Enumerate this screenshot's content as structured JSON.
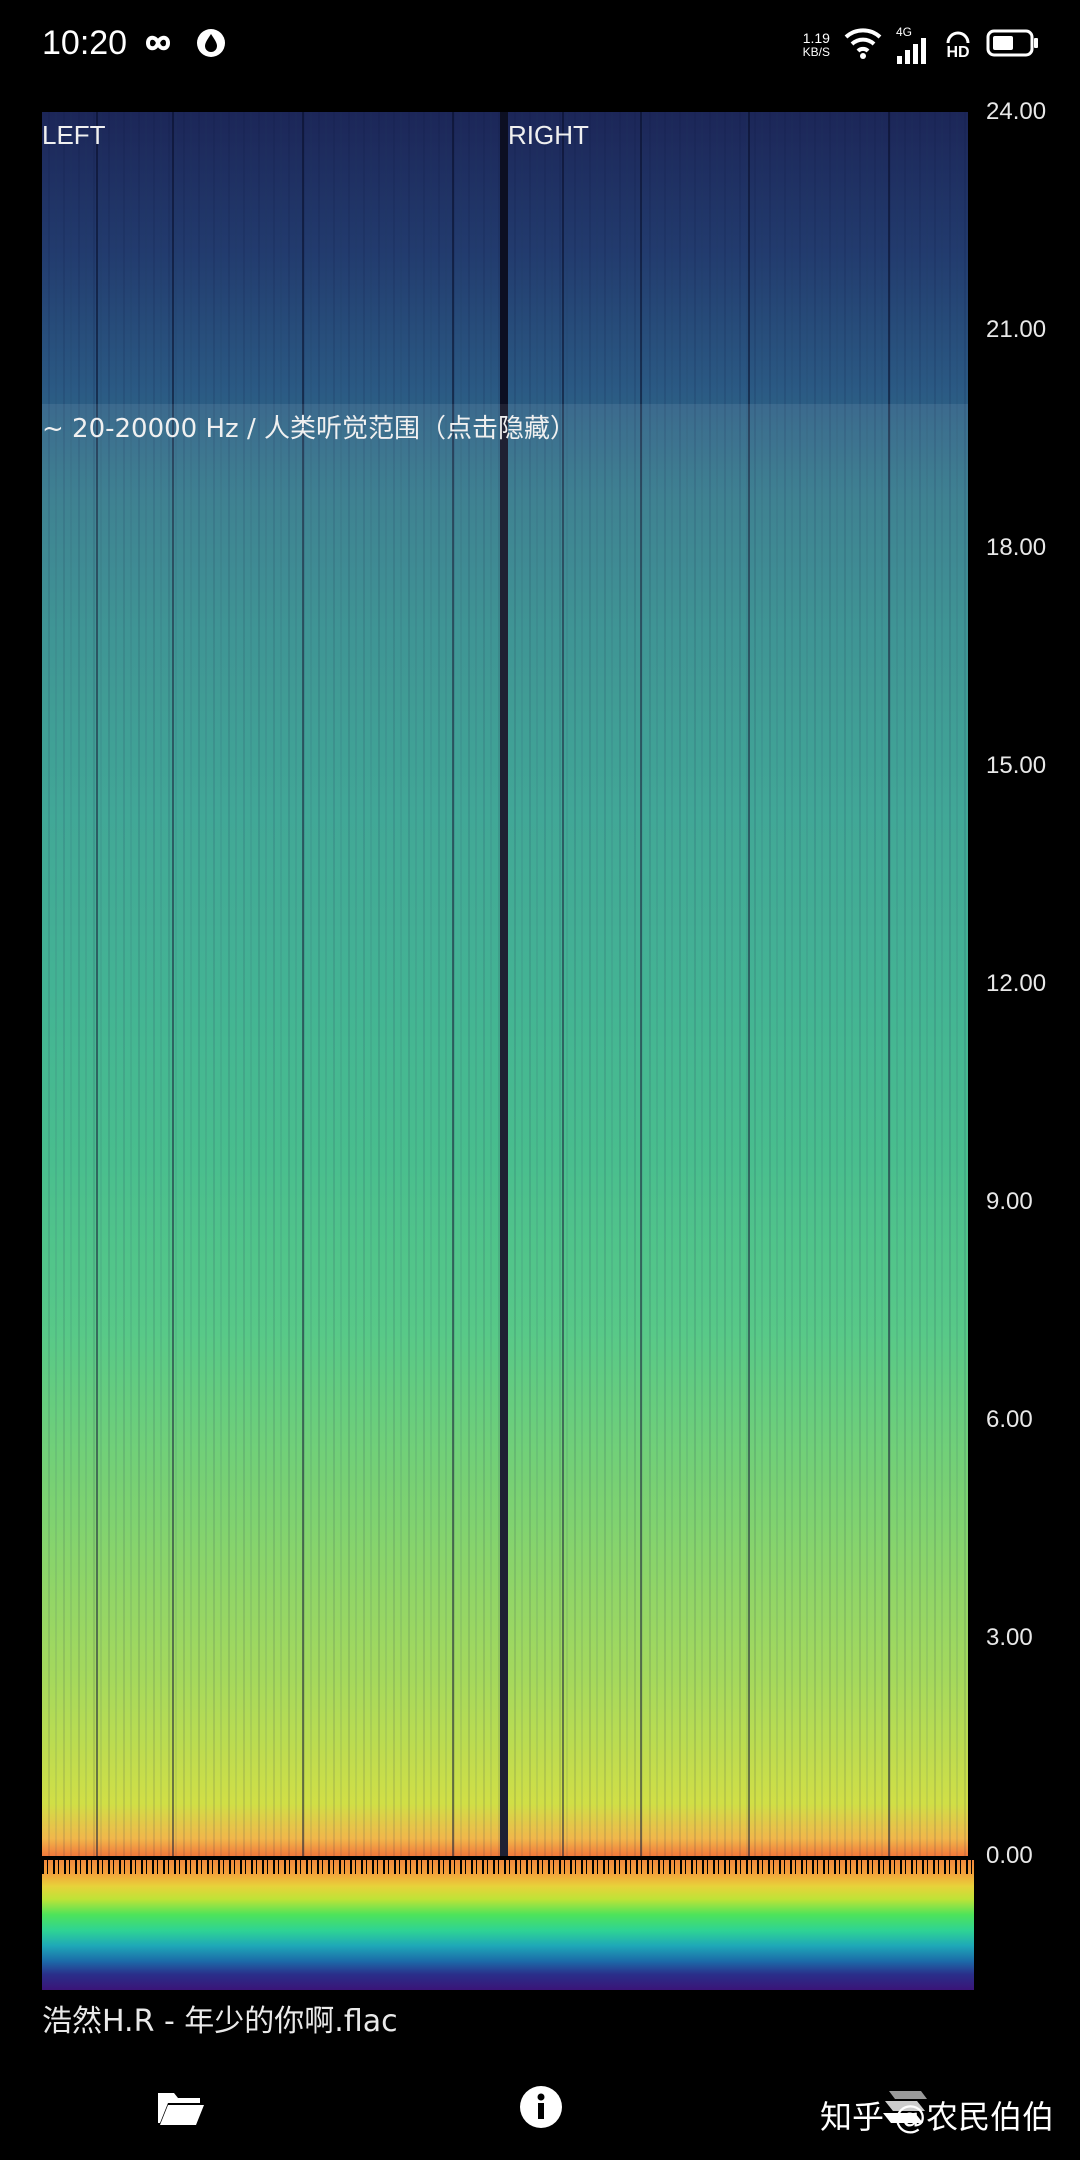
{
  "status_bar": {
    "time": "10:20",
    "net_speed_value": "1.19",
    "net_speed_unit": "KB/S",
    "signal_label": "4G",
    "hd_label": "HD"
  },
  "spectrogram": {
    "left_label": "LEFT",
    "right_label": "RIGHT",
    "hearing_range_label": "~ 20-20000 Hz / 人类听觉范围（点击隐藏）"
  },
  "freq_axis": {
    "ticks": [
      "24.00",
      "21.00",
      "18.00",
      "15.00",
      "12.00",
      "9.00",
      "6.00",
      "3.00",
      "0.00"
    ]
  },
  "file": {
    "name": "浩然H.R - 年少的你啊.flac"
  },
  "toolbar": {
    "open_icon": "folder-open-icon",
    "info_icon": "info-icon",
    "layers_icon": "layers-icon"
  },
  "watermark": "知乎 @农民伯伯",
  "colors": {
    "background": "#000000",
    "spectrum_low": "#f06d2b",
    "spectrum_mid": "#34ad8b",
    "spectrum_high": "#1c2658"
  }
}
